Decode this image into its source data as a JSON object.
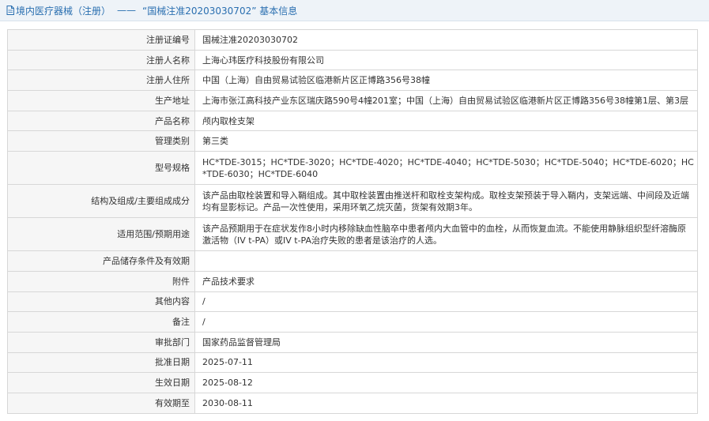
{
  "header": {
    "title": "境内医疗器械（注册）",
    "separator": "——",
    "subtitle": "“国械注准20203030702” 基本信息"
  },
  "rows": [
    {
      "label": "注册证编号",
      "value": "国械注准20203030702"
    },
    {
      "label": "注册人名称",
      "value": "上海心玮医疗科技股份有限公司"
    },
    {
      "label": "注册人住所",
      "value": "中国（上海）自由贸易试验区临港新片区正博路356号38幢"
    },
    {
      "label": "生产地址",
      "value": "上海市张江高科技产业东区瑞庆路590号4幢201室；中国（上海）自由贸易试验区临港新片区正博路356号38幢第1层、第3层"
    },
    {
      "label": "产品名称",
      "value": "颅内取栓支架"
    },
    {
      "label": "管理类别",
      "value": "第三类"
    },
    {
      "label": "型号规格",
      "value": "HC*TDE-3015；HC*TDE-3020；HC*TDE-4020；HC*TDE-4040；HC*TDE-5030；HC*TDE-5040；HC*TDE-6020；HC*TDE-6030；HC*TDE-6040"
    },
    {
      "label": "结构及组成/主要组成成分",
      "value": "该产品由取栓装置和导入鞘组成。其中取栓装置由推送杆和取栓支架构成。取栓支架预装于导入鞘内，支架远端、中间段及近端均有显影标记。产品一次性使用，采用环氧乙烷灭菌，货架有效期3年。"
    },
    {
      "label": "适用范围/预期用途",
      "value": "该产品预期用于在症状发作8小时内移除缺血性脑卒中患者颅内大血管中的血栓，从而恢复血流。不能使用静脉组织型纤溶酶原激活物（IV t-PA）或IV t-PA治疗失败的患者是该治疗的人选。"
    },
    {
      "label": "产品储存条件及有效期",
      "value": ""
    },
    {
      "label": "附件",
      "value": "产品技术要求"
    },
    {
      "label": "其他内容",
      "value": "/"
    },
    {
      "label": "备注",
      "value": "/"
    },
    {
      "label": "审批部门",
      "value": "国家药品监督管理局"
    },
    {
      "label": "批准日期",
      "value": "2025-07-11"
    },
    {
      "label": "生效日期",
      "value": "2025-08-12"
    },
    {
      "label": "有效期至",
      "value": "2030-08-11"
    }
  ]
}
